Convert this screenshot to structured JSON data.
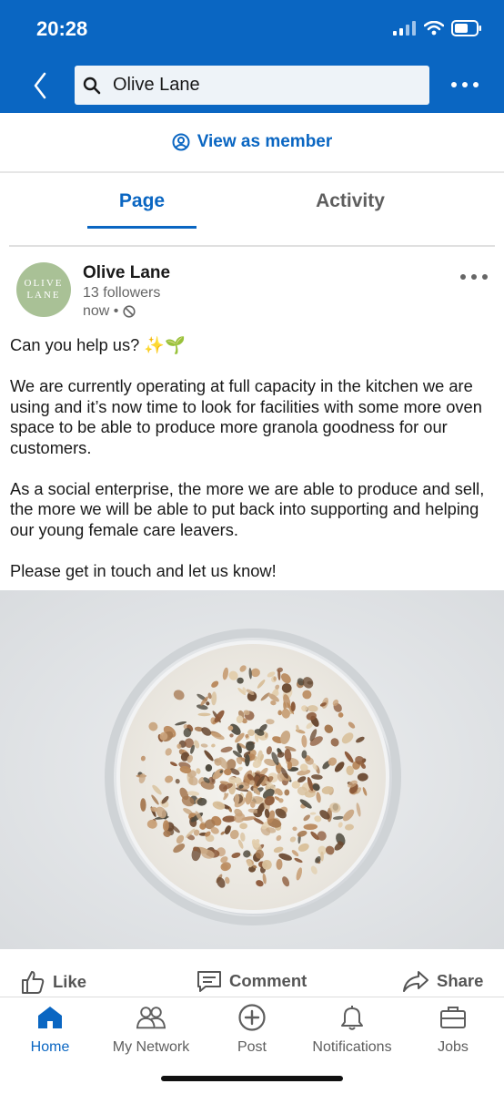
{
  "status_bar": {
    "time": "20:28"
  },
  "header": {
    "search_text": "Olive Lane",
    "icons": [
      "back-chevron-icon",
      "search-icon",
      "more-dots-icon"
    ]
  },
  "view_as_member": {
    "label": "View as member",
    "icon": "member-eye-icon"
  },
  "tabs": [
    {
      "label": "Page",
      "active": true
    },
    {
      "label": "Activity",
      "active": false
    }
  ],
  "post": {
    "author": {
      "name": "Olive Lane",
      "followers": "13 followers",
      "time": "now •",
      "avatar_text_line1": "OLIVE",
      "avatar_text_line2": "LANE"
    },
    "paragraphs": [
      "Can you help us? ✨🌱",
      "We are currently operating at full capacity in the kitchen we are using and it’s now time to look for facilities with some more oven space to be able to produce more granola goodness for our customers.",
      "As a social enterprise, the more we are able to produce and sell, the more we will be able to put back into supporting and helping our young female care leavers.",
      "Please get in touch and let us know!"
    ],
    "actions": {
      "like": "Like",
      "comment": "Comment",
      "share": "Share"
    }
  },
  "bottom_nav": [
    {
      "label": "Home",
      "icon": "home-icon",
      "active": true
    },
    {
      "label": "My Network",
      "icon": "network-icon",
      "active": false
    },
    {
      "label": "Post",
      "icon": "post-plus-icon",
      "active": false
    },
    {
      "label": "Notifications",
      "icon": "bell-icon",
      "active": false
    },
    {
      "label": "Jobs",
      "icon": "briefcase-icon",
      "active": false
    }
  ],
  "colors": {
    "brand_blue": "#0a66c2",
    "avatar_green": "#a9c196",
    "muted_text": "#666666"
  }
}
